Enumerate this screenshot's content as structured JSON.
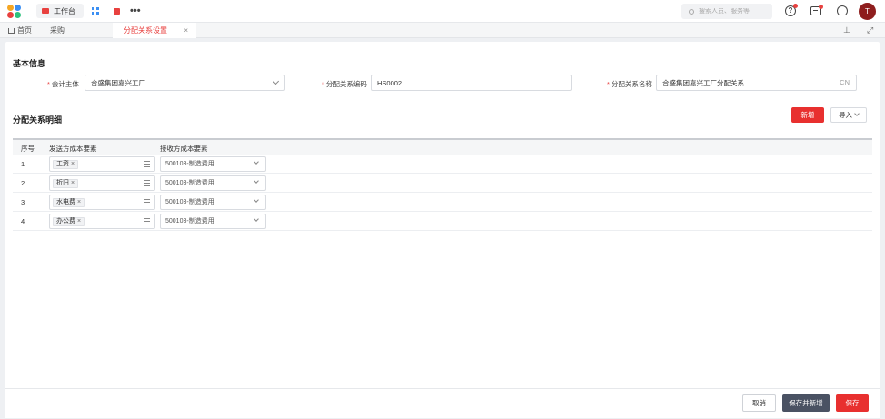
{
  "topbar": {
    "workbench_label": "工作台",
    "more_label": "•••",
    "search_placeholder": "搜索人员、服务等",
    "help_glyph": "?",
    "avatar_initial": "T"
  },
  "tabs": [
    {
      "label": "首页"
    },
    {
      "label": "采购"
    },
    {
      "label": "分配关系设置",
      "close": "×"
    }
  ],
  "tabbar_icons": {
    "pin": "⊥",
    "expand": "⤢"
  },
  "basic_info": {
    "title": "基本信息",
    "fields": [
      {
        "required": "*",
        "label": "会计主体",
        "value": "合盛集团嘉兴工厂"
      },
      {
        "required": "*",
        "label": "分配关系编码",
        "value": "HS0002"
      },
      {
        "required": "*",
        "label": "分配关系名称",
        "value": "合盛集团嘉兴工厂分配关系",
        "suffix": "CN"
      }
    ]
  },
  "detail": {
    "title": "分配关系明细",
    "add_label": "新增",
    "import_label": "导入",
    "columns": [
      "序号",
      "发送方成本要素",
      "接收方成本要素"
    ],
    "rows": [
      {
        "index": "1",
        "sender": "工资",
        "receiver": "500103-制造费用"
      },
      {
        "index": "2",
        "sender": "折旧",
        "receiver": "500103-制造费用"
      },
      {
        "index": "3",
        "sender": "水电费",
        "receiver": "500103-制造费用"
      },
      {
        "index": "4",
        "sender": "办公费",
        "receiver": "500103-制造费用"
      }
    ],
    "tag_remove": "×"
  },
  "footer": {
    "cancel_label": "取消",
    "save_new_label": "保存并新增",
    "save_label": "保存"
  },
  "colors": {
    "accent": "#e8302f",
    "dark_button": "#4a5263",
    "avatar": "#8e1d1d"
  }
}
